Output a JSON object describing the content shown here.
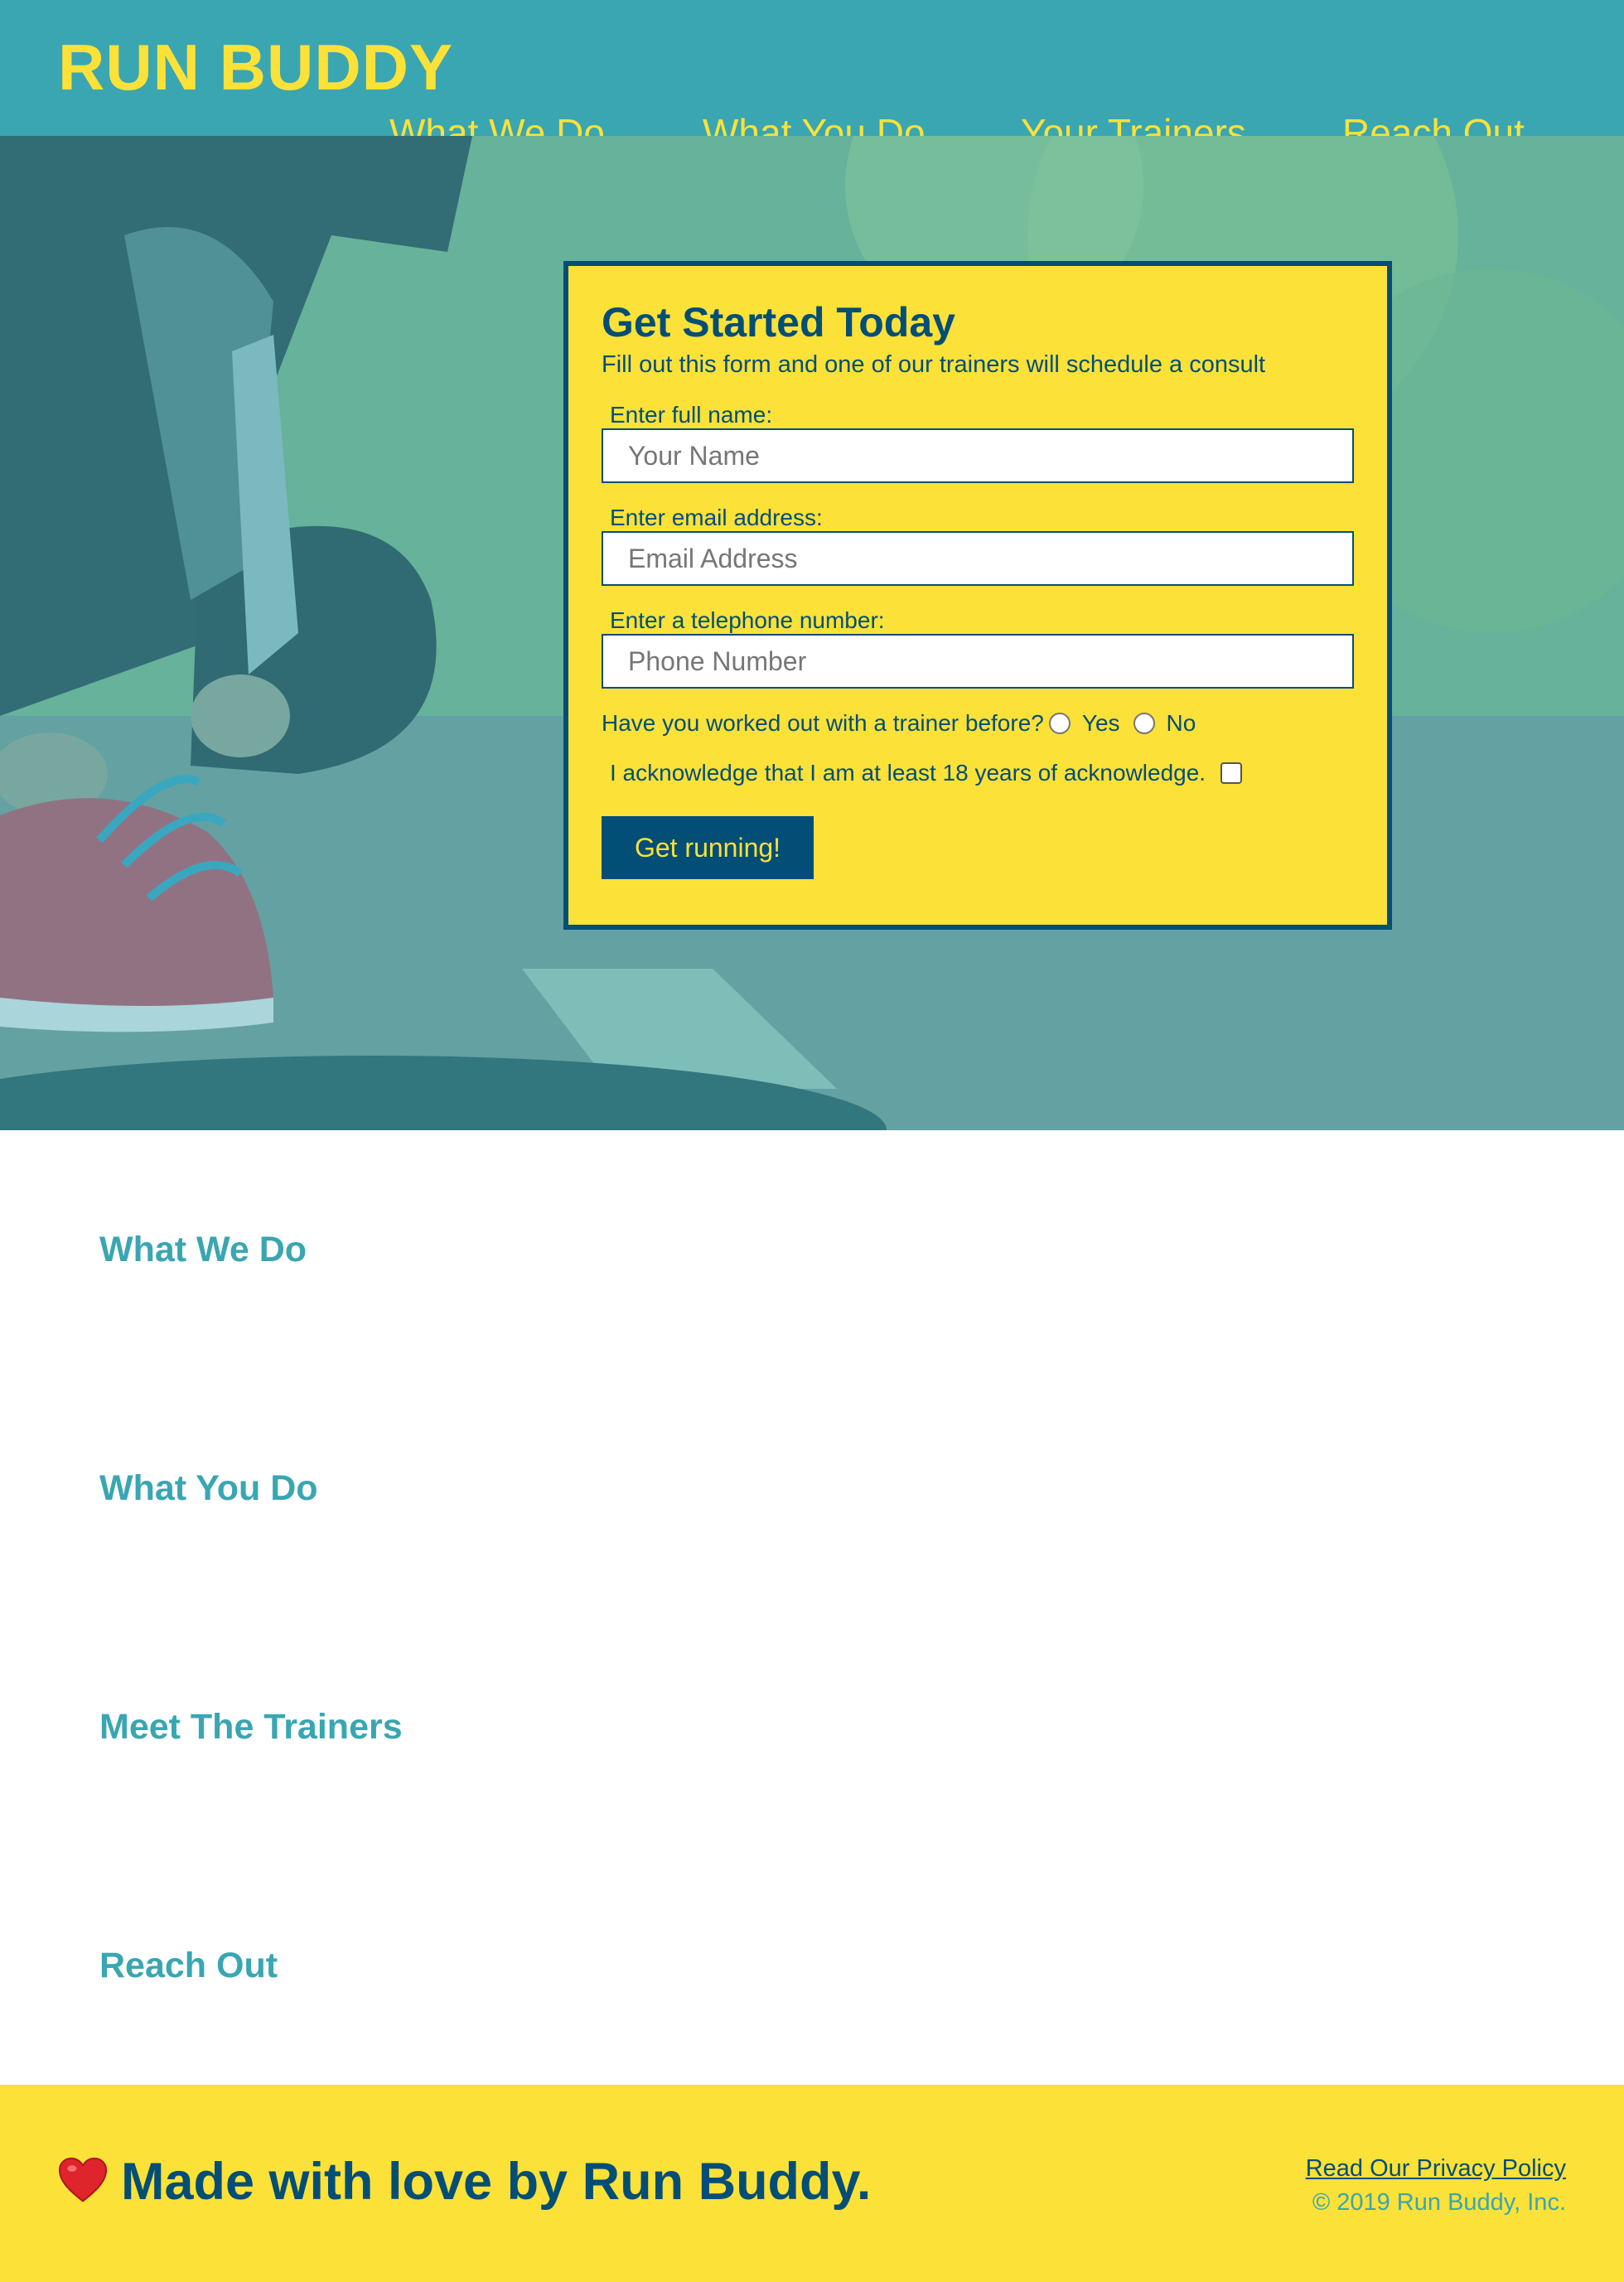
{
  "header": {
    "logo": "RUN BUDDY",
    "nav": [
      "What We Do",
      "What You Do",
      "Your Trainers",
      "Reach Out"
    ]
  },
  "form": {
    "title": "Get Started Today",
    "subtitle": "Fill out this form and one of our trainers will schedule a consult",
    "name_label": "Enter full name:",
    "name_placeholder": "Your Name",
    "email_label": "Enter email address:",
    "email_placeholder": "Email Address",
    "phone_label": "Enter a telephone number:",
    "phone_placeholder": "Phone Number",
    "trainer_question": "Have you worked out with a trainer before?",
    "yes": "Yes",
    "no": "No",
    "acknowledge": "I acknowledge that I am at least 18 years of acknowledge.",
    "submit": "Get running!"
  },
  "sections": [
    "What We Do",
    "What You Do",
    "Meet The Trainers",
    "Reach Out"
  ],
  "footer": {
    "made": "Made with love by Run Buddy.",
    "privacy": "Read Our Privacy Policy",
    "copyright": "© 2019 Run Buddy, Inc."
  },
  "colors": {
    "primary": "#39a6b2",
    "accent": "#fce138",
    "dark": "#024e76"
  },
  "icons": {
    "footer_heart": "heart-icon"
  }
}
